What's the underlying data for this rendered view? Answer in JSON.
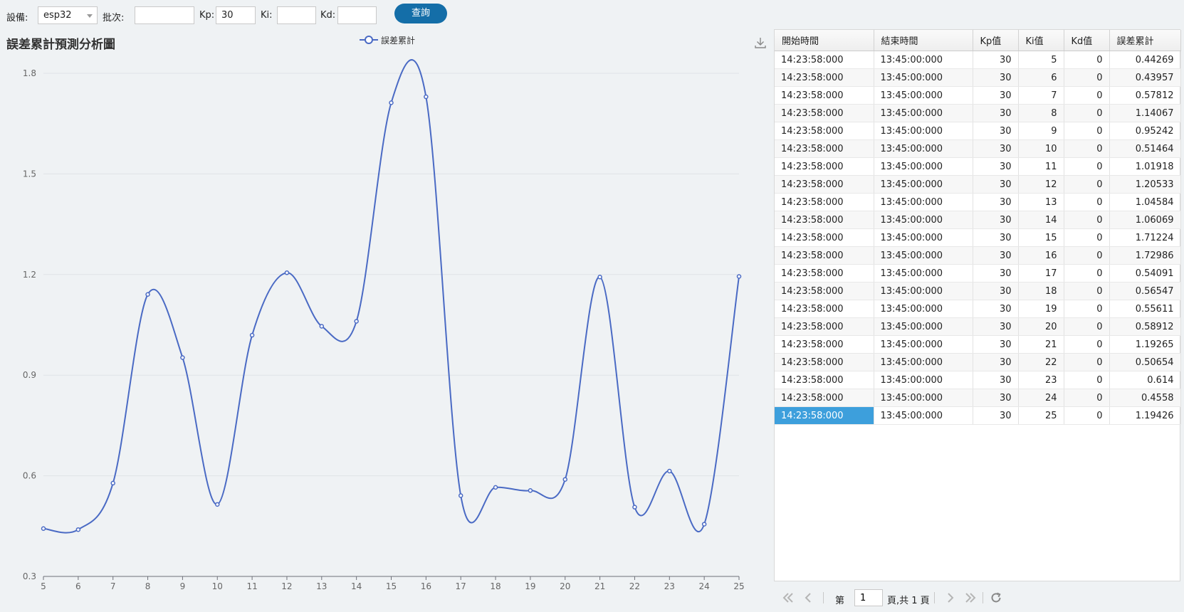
{
  "toolbar": {
    "device_label": "設備:",
    "device_value": "esp32",
    "batch_label": "批次:",
    "batch_value": "",
    "kp_label": "Kp:",
    "kp_value": "30",
    "ki_label": "Ki:",
    "ki_value": "",
    "kd_label": "Kd:",
    "kd_value": "",
    "query_label": "查詢"
  },
  "chart_data": {
    "type": "line",
    "title": "誤差累計預測分析圖",
    "x": [
      5,
      6,
      7,
      8,
      9,
      10,
      11,
      12,
      13,
      14,
      15,
      16,
      17,
      18,
      19,
      20,
      21,
      22,
      23,
      24,
      25
    ],
    "x_tick_labels": [
      "5",
      "6",
      "7",
      "8",
      "9",
      "10",
      "11",
      "12",
      "13",
      "14",
      "15",
      "16",
      "17",
      "18",
      "19",
      "20",
      "21",
      "22",
      "23",
      "24",
      "25"
    ],
    "series": [
      {
        "name": "誤差累計",
        "values": [
          0.44269,
          0.43957,
          0.57812,
          1.14067,
          0.95242,
          0.51464,
          1.01918,
          1.20533,
          1.04584,
          1.06069,
          1.71224,
          1.72986,
          0.54091,
          0.56547,
          0.55611,
          0.58912,
          1.19265,
          0.50654,
          0.614,
          0.4558,
          1.19426
        ],
        "color": "#4a6ac4",
        "smooth": true
      }
    ],
    "ylim": [
      0.3,
      1.8
    ],
    "y_ticks": [
      0.3,
      0.6,
      0.9,
      1.2,
      1.5,
      1.8
    ],
    "y_tick_labels": [
      "0.3",
      "0.6",
      "0.9",
      "1.2",
      "1.5",
      "1.8"
    ],
    "xlabel": "",
    "ylabel": "",
    "grid": "horizontal",
    "legend_position": "top-center"
  },
  "grid": {
    "headers": [
      "開始時間",
      "結束時間",
      "Kp值",
      "Ki值",
      "Kd值",
      "誤差累計"
    ],
    "rows": [
      [
        "14:23:58:000",
        "13:45:00:000",
        "30",
        "5",
        "0",
        "0.44269"
      ],
      [
        "14:23:58:000",
        "13:45:00:000",
        "30",
        "6",
        "0",
        "0.43957"
      ],
      [
        "14:23:58:000",
        "13:45:00:000",
        "30",
        "7",
        "0",
        "0.57812"
      ],
      [
        "14:23:58:000",
        "13:45:00:000",
        "30",
        "8",
        "0",
        "1.14067"
      ],
      [
        "14:23:58:000",
        "13:45:00:000",
        "30",
        "9",
        "0",
        "0.95242"
      ],
      [
        "14:23:58:000",
        "13:45:00:000",
        "30",
        "10",
        "0",
        "0.51464"
      ],
      [
        "14:23:58:000",
        "13:45:00:000",
        "30",
        "11",
        "0",
        "1.01918"
      ],
      [
        "14:23:58:000",
        "13:45:00:000",
        "30",
        "12",
        "0",
        "1.20533"
      ],
      [
        "14:23:58:000",
        "13:45:00:000",
        "30",
        "13",
        "0",
        "1.04584"
      ],
      [
        "14:23:58:000",
        "13:45:00:000",
        "30",
        "14",
        "0",
        "1.06069"
      ],
      [
        "14:23:58:000",
        "13:45:00:000",
        "30",
        "15",
        "0",
        "1.71224"
      ],
      [
        "14:23:58:000",
        "13:45:00:000",
        "30",
        "16",
        "0",
        "1.72986"
      ],
      [
        "14:23:58:000",
        "13:45:00:000",
        "30",
        "17",
        "0",
        "0.54091"
      ],
      [
        "14:23:58:000",
        "13:45:00:000",
        "30",
        "18",
        "0",
        "0.56547"
      ],
      [
        "14:23:58:000",
        "13:45:00:000",
        "30",
        "19",
        "0",
        "0.55611"
      ],
      [
        "14:23:58:000",
        "13:45:00:000",
        "30",
        "20",
        "0",
        "0.58912"
      ],
      [
        "14:23:58:000",
        "13:45:00:000",
        "30",
        "21",
        "0",
        "1.19265"
      ],
      [
        "14:23:58:000",
        "13:45:00:000",
        "30",
        "22",
        "0",
        "0.50654"
      ],
      [
        "14:23:58:000",
        "13:45:00:000",
        "30",
        "23",
        "0",
        "0.614"
      ],
      [
        "14:23:58:000",
        "13:45:00:000",
        "30",
        "24",
        "0",
        "0.4558"
      ],
      [
        "14:23:58:000",
        "13:45:00:000",
        "30",
        "25",
        "0",
        "1.19426"
      ]
    ],
    "selected_row": 20,
    "selection_color": "#3d9fdc"
  },
  "pager": {
    "page_prefix": "第",
    "page_value": "1",
    "page_suffix": "頁,共 1 頁"
  },
  "icons": {
    "download": "download-icon",
    "first": "first-page-icon",
    "prev": "prev-page-icon",
    "next": "next-page-icon",
    "last": "last-page-icon",
    "refresh": "refresh-icon"
  },
  "colors": {
    "accent_button": "#146ea8",
    "line": "#4a6ac4",
    "background": "#eff2f4"
  }
}
